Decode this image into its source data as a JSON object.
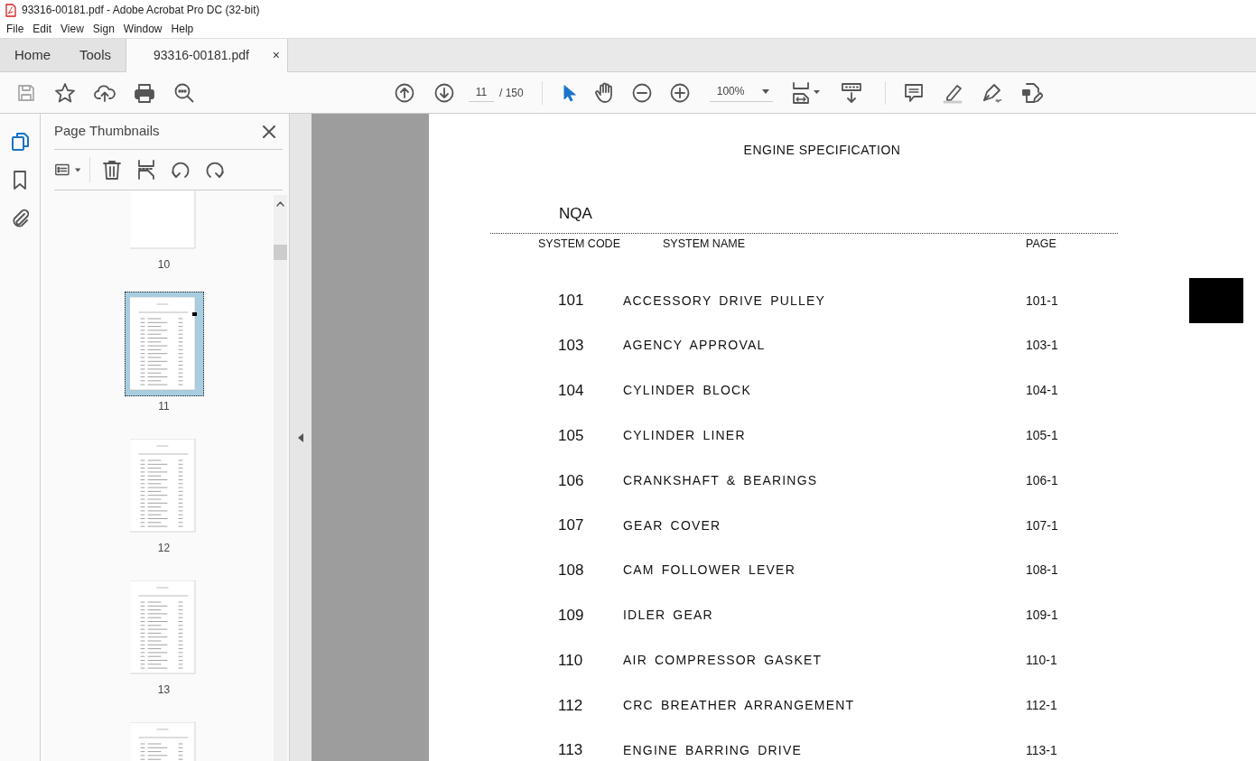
{
  "window": {
    "title": "93316-00181.pdf - Adobe Acrobat Pro DC (32-bit)"
  },
  "menu": [
    "File",
    "Edit",
    "View",
    "Sign",
    "Window",
    "Help"
  ],
  "tabs": [
    {
      "label": "Home",
      "selected": false,
      "kind": "nav"
    },
    {
      "label": "Tools",
      "selected": false,
      "kind": "nav"
    },
    {
      "label": "93316-00181.pdf",
      "selected": true,
      "kind": "document",
      "close": "×"
    }
  ],
  "toolbar": {
    "page": "11",
    "page_total": "/ 150",
    "zoom": "100%"
  },
  "panel": {
    "title": "Page Thumbnails",
    "thumbnails": [
      {
        "label": "10",
        "selected": false,
        "kind": "blank"
      },
      {
        "label": "11",
        "selected": true,
        "kind": "list"
      },
      {
        "label": "12",
        "selected": false,
        "kind": "list"
      },
      {
        "label": "13",
        "selected": false,
        "kind": "list"
      },
      {
        "kind": "list",
        "selected": false
      }
    ]
  },
  "document": {
    "heading": "ENGINE SPECIFICATION",
    "model": "NQA",
    "columns": [
      "SYSTEM CODE",
      "SYSTEM NAME",
      "PAGE"
    ],
    "rows": [
      {
        "code": "101",
        "name": "ACCESSORY DRIVE PULLEY",
        "page": "101-1"
      },
      {
        "code": "103",
        "name": "AGENCY APPROVAL",
        "page": "103-1"
      },
      {
        "code": "104",
        "name": "CYLINDER BLOCK",
        "page": "104-1"
      },
      {
        "code": "105",
        "name": "CYLINDER LINER",
        "page": "105-1"
      },
      {
        "code": "106",
        "name": "CRANKSHAFT & BEARINGS",
        "page": "106-1"
      },
      {
        "code": "107",
        "name": "GEAR COVER",
        "page": "107-1"
      },
      {
        "code": "108",
        "name": "CAM FOLLOWER LEVER",
        "page": "108-1"
      },
      {
        "code": "109",
        "name": "IDLER GEAR",
        "page": "109-1"
      },
      {
        "code": "110",
        "name": "AIR COMPRESSOR GASKET",
        "page": "110-1"
      },
      {
        "code": "112",
        "name": "CRC BREATHER ARRANGEMENT",
        "page": "112-1"
      },
      {
        "code": "113",
        "name": "ENGINE BARRING DRIVE",
        "page": "113-1"
      }
    ]
  }
}
